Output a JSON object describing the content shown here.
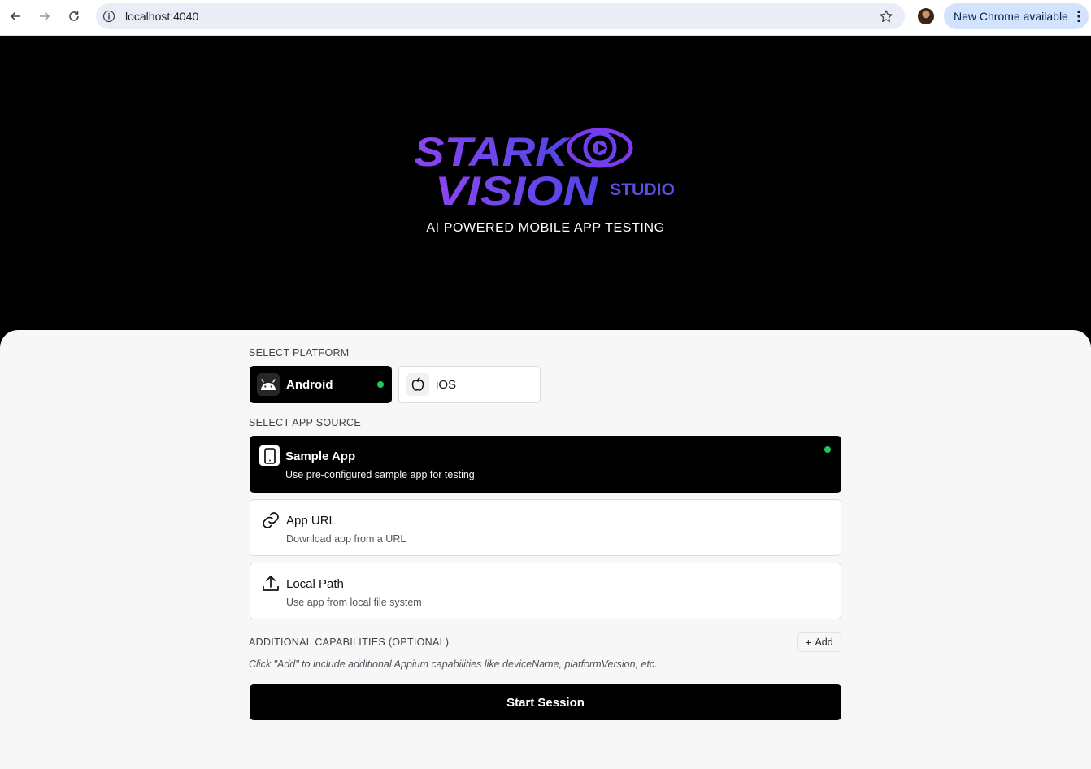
{
  "browser": {
    "url": "localhost:4040",
    "update_label": "New Chrome available"
  },
  "hero": {
    "logo_line1": "STARK",
    "logo_line2": "VISION",
    "logo_suffix": "STUDIO",
    "tagline": "AI POWERED MOBILE APP TESTING",
    "colors": {
      "logo_gradient_start": "#7c3aed",
      "logo_gradient_end": "#4f46e5"
    }
  },
  "platform": {
    "section_label": "SELECT PLATFORM",
    "options": [
      {
        "label": "Android",
        "icon": "android-icon",
        "selected": true
      },
      {
        "label": "iOS",
        "icon": "apple-icon",
        "selected": false
      }
    ]
  },
  "app_source": {
    "section_label": "SELECT APP SOURCE",
    "options": [
      {
        "title": "Sample App",
        "description": "Use pre-configured sample app for testing",
        "icon": "smartphone-icon",
        "selected": true
      },
      {
        "title": "App URL",
        "description": "Download app from a URL",
        "icon": "link-icon",
        "selected": false
      },
      {
        "title": "Local Path",
        "description": "Use app from local file system",
        "icon": "upload-icon",
        "selected": false
      }
    ]
  },
  "capabilities": {
    "section_label": "ADDITIONAL CAPABILITIES (OPTIONAL)",
    "add_label": "Add",
    "hint": "Click \"Add\" to include additional Appium capabilities like deviceName, platformVersion, etc."
  },
  "start_label": "Start Session",
  "colors": {
    "selected_indicator": "#22c55e",
    "primary": "#000000",
    "panel_bg": "#f7f7f8"
  }
}
